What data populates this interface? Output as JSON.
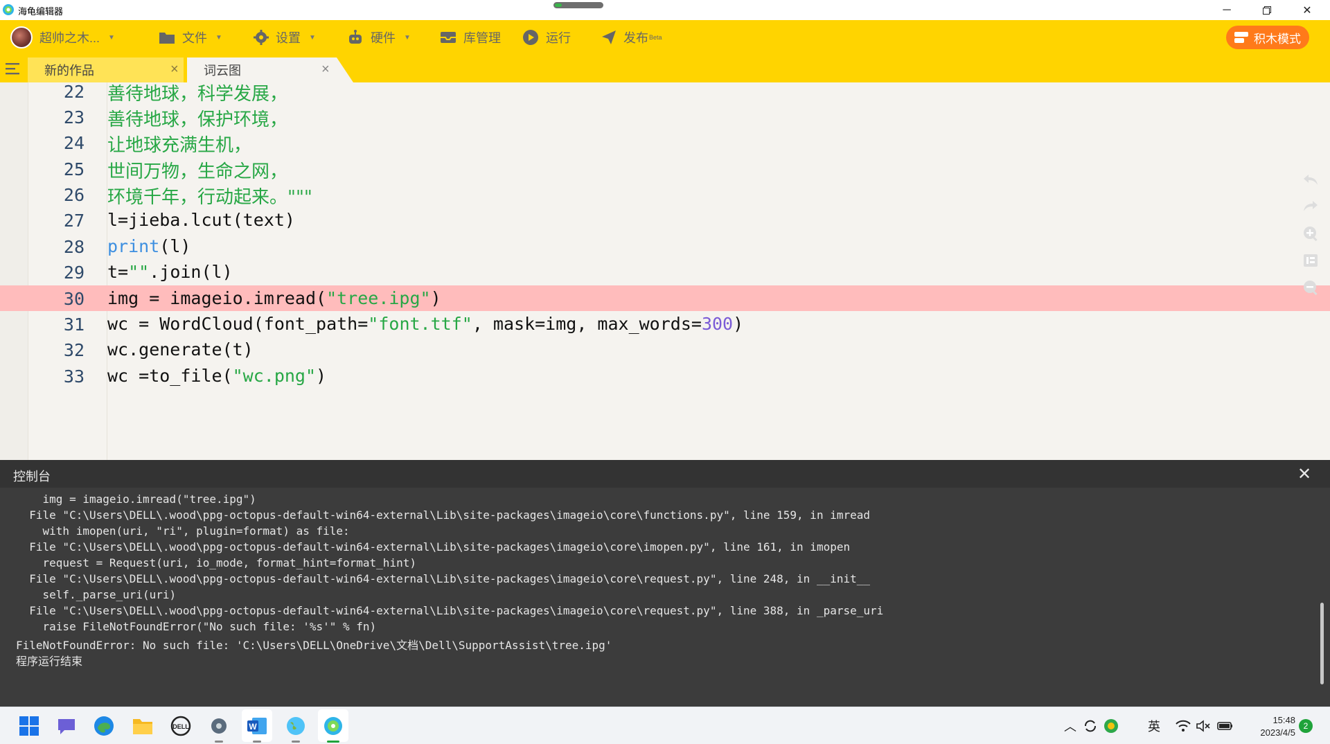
{
  "window": {
    "title": "海龟编辑器"
  },
  "toolbar": {
    "user_name": "超帅之木...",
    "file": "文件",
    "settings": "设置",
    "hardware": "硬件",
    "library": "库管理",
    "run": "运行",
    "publish": "发布",
    "publish_badge": "Beta",
    "mode_button": "积木模式"
  },
  "tabs": [
    {
      "label": "新的作品",
      "active": false
    },
    {
      "label": "词云图",
      "active": true
    }
  ],
  "editor": {
    "highlighted_line": 30,
    "lines": [
      {
        "n": "22",
        "text": "善待地球，科学发展，",
        "kind": "string-cn"
      },
      {
        "n": "23",
        "text": "善待地球，保护环境，",
        "kind": "string-cn"
      },
      {
        "n": "24",
        "text": "让地球充满生机，",
        "kind": "string-cn"
      },
      {
        "n": "25",
        "text": "世间万物，生命之网，",
        "kind": "string-cn"
      },
      {
        "n": "26",
        "text": "环境千年，行动起来。\"\"\"",
        "kind": "string-cn"
      },
      {
        "n": "27",
        "text": "l=jieba.lcut(text)",
        "kind": "code"
      },
      {
        "n": "28",
        "text": "print(l)",
        "kind": "code"
      },
      {
        "n": "29",
        "text": "t=\"\".join(l)",
        "kind": "code"
      },
      {
        "n": "30",
        "text": "img = imageio.imread(\"tree.ipg\")",
        "kind": "code"
      },
      {
        "n": "31",
        "text": "wc = WordCloud(font_path=\"font.ttf\", mask=img, max_words=300)",
        "kind": "code"
      },
      {
        "n": "32",
        "text": "wc.generate(t)",
        "kind": "code"
      },
      {
        "n": "33",
        "text": "wc =to_file(\"wc.png\")",
        "kind": "code"
      }
    ],
    "run_button": "运行"
  },
  "console": {
    "title": "控制台",
    "lines": [
      "    img = imageio.imread(\"tree.ipg\")",
      "  File \"C:\\Users\\DELL\\.wood\\ppg-octopus-default-win64-external\\Lib\\site-packages\\imageio\\core\\functions.py\", line 159, in imread",
      "    with imopen(uri, \"ri\", plugin=format) as file:",
      "  File \"C:\\Users\\DELL\\.wood\\ppg-octopus-default-win64-external\\Lib\\site-packages\\imageio\\core\\imopen.py\", line 161, in imopen",
      "    request = Request(uri, io_mode, format_hint=format_hint)",
      "  File \"C:\\Users\\DELL\\.wood\\ppg-octopus-default-win64-external\\Lib\\site-packages\\imageio\\core\\request.py\", line 248, in __init__",
      "    self._parse_uri(uri)",
      "  File \"C:\\Users\\DELL\\.wood\\ppg-octopus-default-win64-external\\Lib\\site-packages\\imageio\\core\\request.py\", line 388, in _parse_uri",
      "    raise FileNotFoundError(\"No such file: '%s'\" % fn)",
      "FileNotFoundError: No such file: 'C:\\Users\\DELL\\OneDrive\\文档\\Dell\\SupportAssist\\tree.ipg'",
      "程序运行结束"
    ]
  },
  "taskbar": {
    "ime": "英",
    "time": "15:48",
    "date": "2023/4/5",
    "notifications": "2"
  },
  "colors": {
    "toolbar_bg": "#ffd400",
    "highlight_line": "#ffbcbc",
    "string_green": "#27a745",
    "keyword_blue": "#3d8fe0",
    "number_purple": "#7a5bd6",
    "console_bg": "#3c3c3c",
    "mode_button_bg": "#ff7a1a"
  }
}
